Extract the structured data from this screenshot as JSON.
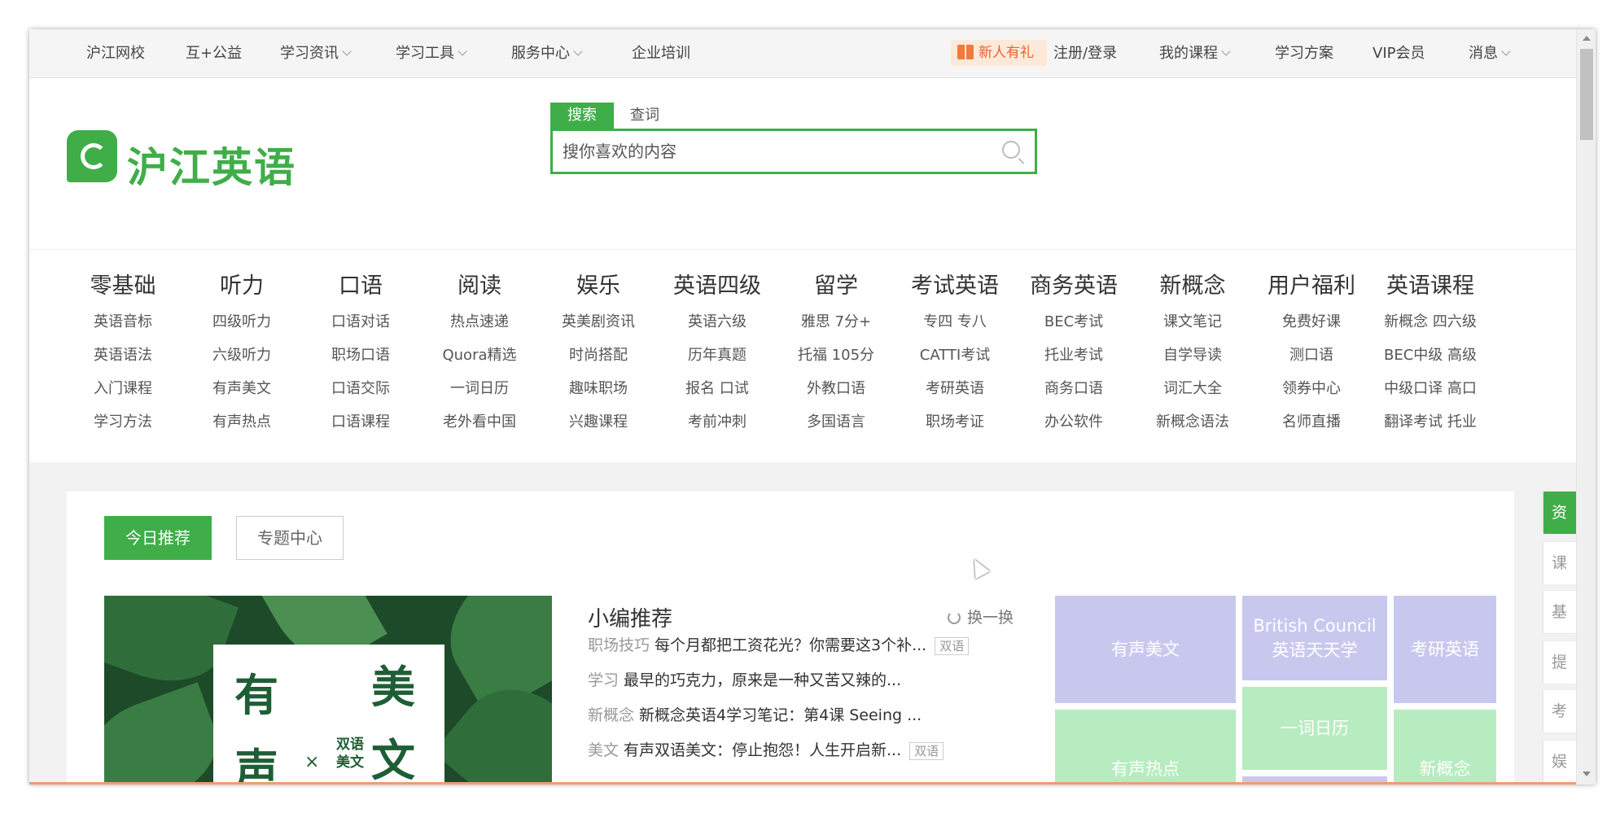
{
  "topnav": {
    "items": [
      "沪江网校",
      "互+公益",
      "学习资讯",
      "学习工具",
      "服务中心",
      "企业培训"
    ],
    "gift": "新人有礼",
    "login": "注册/登录",
    "my_courses": "我的课程",
    "plan": "学习方案",
    "vip": "VIP会员",
    "messages": "消息"
  },
  "logo": {
    "text": "沪江英语"
  },
  "search": {
    "tab_search": "搜索",
    "tab_word": "查词",
    "placeholder": "搜你喜欢的内容"
  },
  "categories": [
    {
      "title": "零基础",
      "links": [
        "英语音标",
        "英语语法",
        "入门课程",
        "学习方法"
      ]
    },
    {
      "title": "听力",
      "links": [
        "四级听力",
        "六级听力",
        "有声美文",
        "有声热点"
      ]
    },
    {
      "title": "口语",
      "links": [
        "口语对话",
        "职场口语",
        "口语交际",
        "口语课程"
      ]
    },
    {
      "title": "阅读",
      "links": [
        "热点速递",
        "Quora精选",
        "一词日历",
        "老外看中国"
      ]
    },
    {
      "title": "娱乐",
      "links": [
        "英美剧资讯",
        "时尚搭配",
        "趣味职场",
        "兴趣课程"
      ]
    },
    {
      "title": "英语四级",
      "links": [
        "英语六级",
        "历年真题",
        "报名 口试",
        "考前冲刺"
      ]
    },
    {
      "title": "留学",
      "links": [
        "雅思 7分+",
        "托福 105分",
        "外教口语",
        "多国语言"
      ]
    },
    {
      "title": "考试英语",
      "links": [
        "专四 专八",
        "CATTI考试",
        "考研英语",
        "职场考证"
      ]
    },
    {
      "title": "商务英语",
      "links": [
        "BEC考试",
        "托业考试",
        "商务口语",
        "办公软件"
      ]
    },
    {
      "title": "新概念",
      "links": [
        "课文笔记",
        "自学导读",
        "词汇大全",
        "新概念语法"
      ]
    },
    {
      "title": "用户福利",
      "links": [
        "免费好课",
        "测口语",
        "领券中心",
        "名师直播"
      ]
    },
    {
      "title": "英语课程",
      "links": [
        "新概念 四六级",
        "BEC中级 高级",
        "中级口译 高口",
        "翻译考试 托业"
      ]
    }
  ],
  "content": {
    "btn_today": "今日推荐",
    "btn_topic": "专题中心",
    "featured": {
      "c1": "有",
      "c2": "美",
      "c3": "声",
      "c4": "文",
      "x": "×",
      "sub1": "双语",
      "sub2": "美文"
    },
    "rec_title": "小编推荐",
    "refresh": "换一换",
    "rec_items": [
      {
        "tag": "职场技巧",
        "text": "每个月都把工资花光？你需要这3个补...",
        "badge": "双语"
      },
      {
        "tag": "学习",
        "text": "最早的巧克力，原来是一种又苦又辣的...",
        "badge": ""
      },
      {
        "tag": "新概念",
        "text": "新概念英语4学习笔记：第4课 Seeing ...",
        "badge": ""
      },
      {
        "tag": "美文",
        "text": "有声双语美文：停止抱怨！人生开启新...",
        "badge": "双语"
      }
    ],
    "tiles": {
      "t1": "有声美文",
      "t2a": "British Council",
      "t2b": "英语天天学",
      "t3": "考研英语",
      "t4": "有声热点",
      "t5": "一词日历",
      "t6": "新概念"
    },
    "side_tabs": [
      "资",
      "课",
      "基",
      "提",
      "考",
      "娱"
    ]
  },
  "colors": {
    "brand_green": "#3fae49",
    "tile_purple": "#c8c8ef",
    "tile_green": "#b6ecbf"
  }
}
